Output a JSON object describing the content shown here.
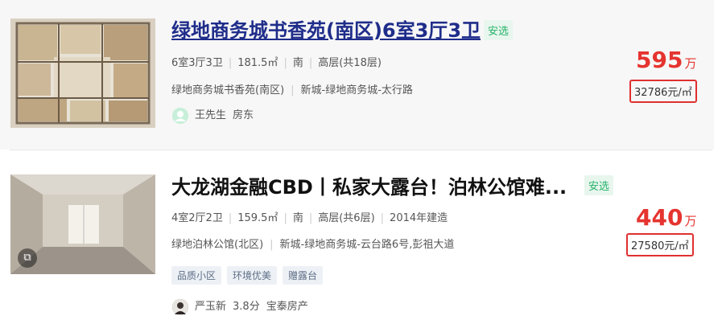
{
  "listings": [
    {
      "title": "绿地商务城书香苑(南区)6室3厅3卫",
      "badge": "安选",
      "layout": "6室3厅3卫",
      "area": "181.5㎡",
      "orientation": "南",
      "floor": "高层(共18层)",
      "community": "绿地商务城书香苑(南区)",
      "location": "新城-绿地商务城-太行路",
      "agent_name": "王先生",
      "agent_role": "房东",
      "price": "595",
      "price_unit": "万",
      "unit_price": "32786元/㎡"
    },
    {
      "title": "大龙湖金融CBD丨私家大露台！泊林公馆难...",
      "badge": "安选",
      "layout": "4室2厅2卫",
      "area": "159.5㎡",
      "orientation": "南",
      "floor": "高层(共6层)",
      "built": "2014年建造",
      "community": "绿地泊林公馆(北区)",
      "location": "新城-绿地商务城-云台路6号,彭祖大道",
      "tags": [
        "品质小区",
        "环境优美",
        "赠露台"
      ],
      "agent_name": "严玉新",
      "agent_score": "3.8分",
      "agent_company": "宝泰房产",
      "price": "440",
      "price_unit": "万",
      "unit_price": "27580元/㎡"
    }
  ],
  "icons": {
    "avatar1": "green-person-avatar-icon",
    "avatar2": "agent-photo-avatar",
    "vr": "vr-view-icon"
  },
  "colors": {
    "price": "#e5342f",
    "badge": "#27b36a",
    "title_link": "#1f2d8a",
    "highlight_box": "#e03030"
  }
}
